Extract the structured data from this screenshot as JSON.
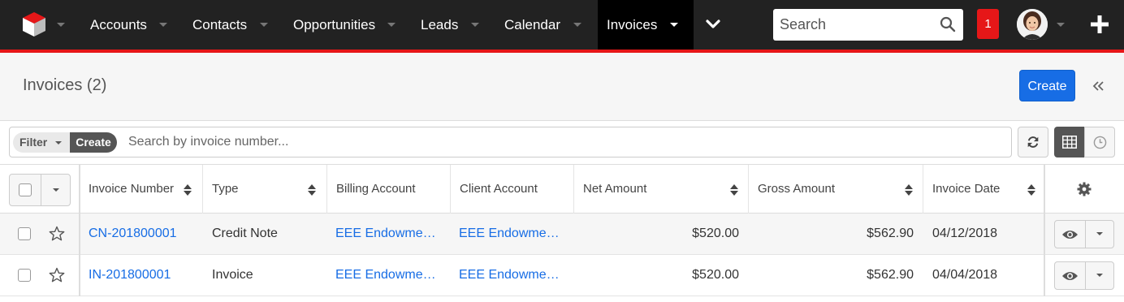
{
  "nav": {
    "items": [
      {
        "label": "Accounts"
      },
      {
        "label": "Contacts"
      },
      {
        "label": "Opportunities"
      },
      {
        "label": "Leads"
      },
      {
        "label": "Calendar"
      },
      {
        "label": "Invoices"
      }
    ],
    "active": "Invoices",
    "search_placeholder": "Search",
    "notification_count": "1",
    "colors": {
      "bar": "#222222",
      "accent": "#e61718",
      "active": "#000000"
    }
  },
  "header": {
    "title": "Invoices (2)",
    "create_label": "Create"
  },
  "filter": {
    "filter_label": "Filter",
    "create_label": "Create",
    "search_placeholder": "Search by invoice number..."
  },
  "table": {
    "columns": [
      {
        "label": "Invoice Number",
        "sortable": true
      },
      {
        "label": "Type",
        "sortable": true
      },
      {
        "label": "Billing Account",
        "sortable": false
      },
      {
        "label": "Client Account",
        "sortable": false
      },
      {
        "label": "Net Amount",
        "sortable": true
      },
      {
        "label": "Gross Amount",
        "sortable": true
      },
      {
        "label": "Invoice Date",
        "sortable": true
      }
    ],
    "rows": [
      {
        "invoice_number": "CN-201800001",
        "type": "Credit Note",
        "billing_account": "EEE Endowme…",
        "client_account": "EEE Endowme…",
        "net_amount": "$520.00",
        "gross_amount": "$562.90",
        "invoice_date": "04/12/2018"
      },
      {
        "invoice_number": "IN-201800001",
        "type": "Invoice",
        "billing_account": "EEE Endowme…",
        "client_account": "EEE Endowme…",
        "net_amount": "$520.00",
        "gross_amount": "$562.90",
        "invoice_date": "04/04/2018"
      }
    ],
    "link_color": "#176de5"
  },
  "icons": {
    "logo": "cube-logo-icon",
    "more": "chevron-down-icon",
    "search": "search-icon",
    "add": "plus-icon",
    "collapse": "double-chevron-left-icon",
    "refresh": "refresh-icon",
    "list_view": "grid-icon",
    "activity": "clock-icon",
    "settings": "gear-icon",
    "favorite": "star-icon",
    "preview": "eye-icon"
  }
}
